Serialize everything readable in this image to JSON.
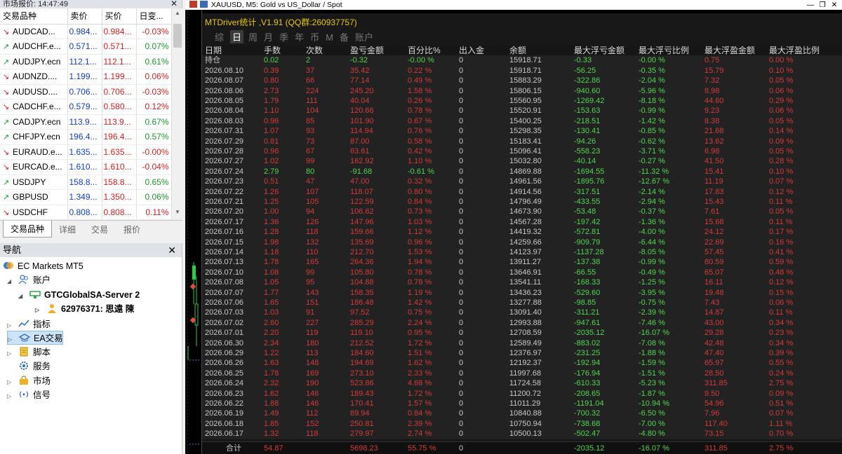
{
  "market_watch": {
    "title": "市场报价: 14:47:49",
    "close": "✕",
    "headers": [
      "交易品种",
      "卖价",
      "买价",
      "日变..."
    ],
    "rows": [
      {
        "symbol": "AUDCAD...",
        "bid": "0.984...",
        "ask": "0.984...",
        "change": "-0.03%",
        "dir": "down"
      },
      {
        "symbol": "AUDCHF.e...",
        "bid": "0.571...",
        "ask": "0.571...",
        "change": "0.07%",
        "dir": "up"
      },
      {
        "symbol": "AUDJPY.ecn",
        "bid": "112.1...",
        "ask": "112.1...",
        "change": "0.61%",
        "dir": "up"
      },
      {
        "symbol": "AUDNZD....",
        "bid": "1.199...",
        "ask": "1.199...",
        "change": "0.06%",
        "dir": "down"
      },
      {
        "symbol": "AUDUSD....",
        "bid": "0.706...",
        "ask": "0.706...",
        "change": "-0.03%",
        "dir": "down"
      },
      {
        "symbol": "CADCHF.e...",
        "bid": "0.579...",
        "ask": "0.580...",
        "change": "0.12%",
        "dir": "down"
      },
      {
        "symbol": "CADJPY.ecn",
        "bid": "113.9...",
        "ask": "113.9...",
        "change": "0.67%",
        "dir": "up"
      },
      {
        "symbol": "CHFJPY.ecn",
        "bid": "196.4...",
        "ask": "196.4...",
        "change": "0.57%",
        "dir": "up"
      },
      {
        "symbol": "EURAUD.e...",
        "bid": "1.635...",
        "ask": "1.635...",
        "change": "-0.00%",
        "dir": "down"
      },
      {
        "symbol": "EURCAD.e...",
        "bid": "1.610...",
        "ask": "1.610...",
        "change": "-0.04%",
        "dir": "down"
      },
      {
        "symbol": "USDJPY",
        "bid": "158.8...",
        "ask": "158.8...",
        "change": "0.65%",
        "dir": "up"
      },
      {
        "symbol": "GBPUSD",
        "bid": "1.349...",
        "ask": "1.350...",
        "change": "0.06%",
        "dir": "up"
      },
      {
        "symbol": "USDCHF",
        "bid": "0.808...",
        "ask": "0.808...",
        "change": "0.11%",
        "dir": "down"
      }
    ],
    "tabs": [
      "交易品种",
      "详细",
      "交易",
      "报价"
    ]
  },
  "navigator": {
    "title": "导航",
    "close": "✕",
    "root": "EC Markets MT5",
    "accounts": "账户",
    "server": "GTCGlobalSA-Server 2",
    "account": "62976371: 思遠 陳",
    "indicators": "指标",
    "ea": "EA交易",
    "scripts": "脚本",
    "services": "服务",
    "market": "市场",
    "signals": "信号"
  },
  "chart": {
    "title": "XAUUSD, M5:  Gold vs US_Dollar / Spot",
    "win_min": "—",
    "win_restore": "❐",
    "win_close": "✕"
  },
  "panel": {
    "title": "MTDriver统计 ,V1.91 (QQ群:260937757)",
    "tabs": [
      "综",
      "日",
      "周",
      "月",
      "季",
      "年",
      "币",
      "M",
      "备",
      "账户"
    ],
    "active_tab": 1,
    "headers": [
      "日期",
      "手数",
      "次数",
      "盈亏金额",
      "百分比%",
      "出入金",
      "余额",
      "最大浮亏金额",
      "最大浮亏比例",
      "最大浮盈金额",
      "最大浮盈比例"
    ],
    "rows": [
      [
        "持仓",
        "0.02",
        "2",
        "-0.32",
        "-0.00 %",
        "0",
        "15918.71",
        "-0.33",
        "-0.00 %",
        "0.75",
        "0.00 %"
      ],
      [
        "2026.08.10",
        "0.39",
        "37",
        "35.42",
        "0.22 %",
        "0",
        "15918.71",
        "-56.25",
        "-0.35 %",
        "15.79",
        "0.10 %"
      ],
      [
        "2026.08.07",
        "0.80",
        "66",
        "77.14",
        "0.49 %",
        "0",
        "15883.29",
        "-322.86",
        "-2.04 %",
        "7.32",
        "0.05 %"
      ],
      [
        "2026.08.06",
        "2.73",
        "224",
        "245.20",
        "1.58 %",
        "0",
        "15806.15",
        "-940.60",
        "-5.96 %",
        "8.98",
        "0.06 %"
      ],
      [
        "2026.08.05",
        "1.79",
        "111",
        "40.04",
        "0.26 %",
        "0",
        "15560.95",
        "-1269.42",
        "-8.18 %",
        "44.60",
        "0.29 %"
      ],
      [
        "2026.08.04",
        "1.10",
        "104",
        "120.66",
        "0.78 %",
        "0",
        "15520.91",
        "-153.63",
        "-0.99 %",
        "9.23",
        "0.06 %"
      ],
      [
        "2026.08.03",
        "0.96",
        "85",
        "101.90",
        "0.67 %",
        "0",
        "15400.25",
        "-218.51",
        "-1.42 %",
        "8.38",
        "0.05 %"
      ],
      [
        "2026.07.31",
        "1.07",
        "93",
        "114.94",
        "0.76 %",
        "0",
        "15298.35",
        "-130.41",
        "-0.85 %",
        "21.68",
        "0.14 %"
      ],
      [
        "2026.07.29",
        "0.81",
        "73",
        "87.00",
        "0.58 %",
        "0",
        "15183.41",
        "-94.26",
        "-0.62 %",
        "13.62",
        "0.09 %"
      ],
      [
        "2026.07.28",
        "0.96",
        "67",
        "63.61",
        "0.42 %",
        "0",
        "15096.41",
        "-558.23",
        "-3.71 %",
        "6.98",
        "0.05 %"
      ],
      [
        "2026.07.27",
        "1.02",
        "99",
        "162.92",
        "1.10 %",
        "0",
        "15032.80",
        "-40.14",
        "-0.27 %",
        "41.50",
        "0.28 %"
      ],
      [
        "2026.07.24",
        "2.79",
        "80",
        "-91.68",
        "-0.61 %",
        "0",
        "14869.88",
        "-1694.55",
        "-11.32 %",
        "15.41",
        "0.10 %"
      ],
      [
        "2026.07.23",
        "0.51",
        "47",
        "47.00",
        "0.32 %",
        "0",
        "14961.56",
        "-1895.76",
        "-12.67 %",
        "11.19",
        "0.07 %"
      ],
      [
        "2026.07.22",
        "1.26",
        "107",
        "118.07",
        "0.80 %",
        "0",
        "14914.56",
        "-317.51",
        "-2.14 %",
        "17.83",
        "0.12 %"
      ],
      [
        "2026.07.21",
        "1.25",
        "105",
        "122.59",
        "0.84 %",
        "0",
        "14796.49",
        "-433.55",
        "-2.94 %",
        "15.43",
        "0.11 %"
      ],
      [
        "2026.07.20",
        "1.00",
        "94",
        "106.62",
        "0.73 %",
        "0",
        "14673.90",
        "-53.48",
        "-0.37 %",
        "7.61",
        "0.05 %"
      ],
      [
        "2026.07.17",
        "1.36",
        "126",
        "147.96",
        "1.03 %",
        "0",
        "14567.28",
        "-197.42",
        "-1.36 %",
        "15.68",
        "0.11 %"
      ],
      [
        "2026.07.16",
        "1.28",
        "118",
        "159.66",
        "1.12 %",
        "0",
        "14419.32",
        "-572.81",
        "-4.00 %",
        "24.12",
        "0.17 %"
      ],
      [
        "2026.07.15",
        "1.98",
        "132",
        "135.69",
        "0.96 %",
        "0",
        "14259.66",
        "-909.79",
        "-6.44 %",
        "22.69",
        "0.16 %"
      ],
      [
        "2026.07.14",
        "1.18",
        "110",
        "212.70",
        "1.53 %",
        "0",
        "14123.97",
        "-1137.28",
        "-8.05 %",
        "57.45",
        "0.41 %"
      ],
      [
        "2026.07.13",
        "1.78",
        "165",
        "264.36",
        "1.94 %",
        "0",
        "13911.27",
        "-137.38",
        "-0.99 %",
        "80.59",
        "0.59 %"
      ],
      [
        "2026.07.10",
        "1.08",
        "99",
        "105.80",
        "0.78 %",
        "0",
        "13646.91",
        "-66.55",
        "-0.49 %",
        "65.07",
        "0.48 %"
      ],
      [
        "2026.07.08",
        "1.05",
        "95",
        "104.88",
        "0.78 %",
        "0",
        "13541.11",
        "-168.33",
        "-1.25 %",
        "16.11",
        "0.12 %"
      ],
      [
        "2026.07.07",
        "1.77",
        "143",
        "158.35",
        "1.19 %",
        "0",
        "13436.23",
        "-529.60",
        "-3.95 %",
        "19.48",
        "0.15 %"
      ],
      [
        "2026.07.06",
        "1.65",
        "151",
        "186.48",
        "1.42 %",
        "0",
        "13277.88",
        "-98.85",
        "-0.75 %",
        "7.43",
        "0.06 %"
      ],
      [
        "2026.07.03",
        "1.03",
        "91",
        "97.52",
        "0.75 %",
        "0",
        "13091.40",
        "-311.21",
        "-2.39 %",
        "14.87",
        "0.11 %"
      ],
      [
        "2026.07.02",
        "2.60",
        "227",
        "285.29",
        "2.24 %",
        "0",
        "12993.88",
        "-947.61",
        "-7.46 %",
        "43.00",
        "0.34 %"
      ],
      [
        "2026.07.01",
        "2.20",
        "119",
        "119.10",
        "0.95 %",
        "0",
        "12708.59",
        "-2035.12",
        "-16.07 %",
        "29.28",
        "0.23 %"
      ],
      [
        "2026.06.30",
        "2.34",
        "180",
        "212.52",
        "1.72 %",
        "0",
        "12589.49",
        "-883.02",
        "-7.08 %",
        "42.48",
        "0.34 %"
      ],
      [
        "2026.06.29",
        "1.22",
        "113",
        "184.60",
        "1.51 %",
        "0",
        "12376.97",
        "-231.25",
        "-1.88 %",
        "47.40",
        "0.39 %"
      ],
      [
        "2026.06.26",
        "1.63",
        "148",
        "194.69",
        "1.62 %",
        "0",
        "12192.37",
        "-192.94",
        "-1.59 %",
        "65.97",
        "0.55 %"
      ],
      [
        "2026.06.25",
        "1.78",
        "169",
        "273.10",
        "2.33 %",
        "0",
        "11997.68",
        "-176.94",
        "-1.51 %",
        "28.50",
        "0.24 %"
      ],
      [
        "2026.06.24",
        "2.32",
        "190",
        "523.86",
        "4.68 %",
        "0",
        "11724.58",
        "-610.33",
        "-5.23 %",
        "311.85",
        "2.75 %"
      ],
      [
        "2026.06.23",
        "1.62",
        "146",
        "189.43",
        "1.72 %",
        "0",
        "11200.72",
        "-208.65",
        "-1.87 %",
        "9.50",
        "0.09 %"
      ],
      [
        "2026.06.22",
        "1.88",
        "146",
        "170.41",
        "1.57 %",
        "0",
        "11011.29",
        "-1191.04",
        "-10.94 %",
        "54.96",
        "0.51 %"
      ],
      [
        "2026.06.19",
        "1.49",
        "112",
        "89.94",
        "0.84 %",
        "0",
        "10840.88",
        "-700.32",
        "-6.50 %",
        "7.96",
        "0.07 %"
      ],
      [
        "2026.06.18",
        "1.85",
        "152",
        "250.81",
        "2.39 %",
        "0",
        "10750.94",
        "-738.68",
        "-7.00 %",
        "117.40",
        "1.11 %"
      ],
      [
        "2026.06.17",
        "1.32",
        "118",
        "279.97",
        "2.74 %",
        "0",
        "10500.13",
        "-502.47",
        "-4.80 %",
        "73.15",
        "0.70 %"
      ]
    ],
    "footer": [
      "合计",
      "54.87",
      "",
      "5698.23",
      "55.75 %",
      "0",
      "",
      "-2035.12",
      "-16.07 %",
      "311.85",
      "2.75 %"
    ]
  },
  "colors": {
    "positive": "#d43a3a",
    "negative": "#4fd64f",
    "title": "#e8c700"
  }
}
